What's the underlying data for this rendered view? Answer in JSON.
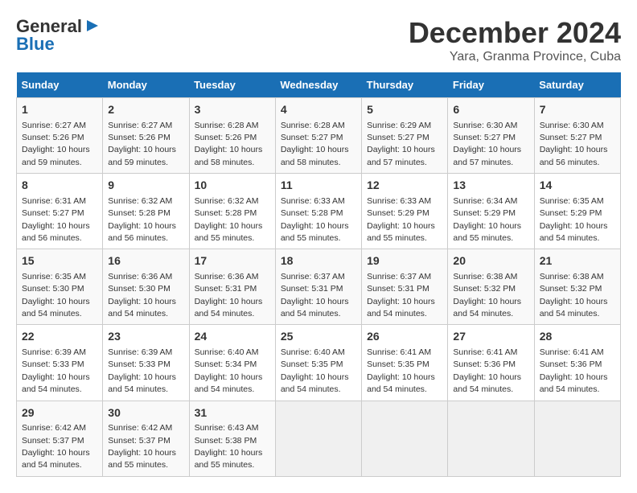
{
  "logo": {
    "line1": "General",
    "line2": "Blue"
  },
  "header": {
    "month": "December 2024",
    "location": "Yara, Granma Province, Cuba"
  },
  "weekdays": [
    "Sunday",
    "Monday",
    "Tuesday",
    "Wednesday",
    "Thursday",
    "Friday",
    "Saturday"
  ],
  "weeks": [
    [
      {
        "day": "1",
        "sunrise": "Sunrise: 6:27 AM",
        "sunset": "Sunset: 5:26 PM",
        "daylight": "Daylight: 10 hours and 59 minutes."
      },
      {
        "day": "2",
        "sunrise": "Sunrise: 6:27 AM",
        "sunset": "Sunset: 5:26 PM",
        "daylight": "Daylight: 10 hours and 59 minutes."
      },
      {
        "day": "3",
        "sunrise": "Sunrise: 6:28 AM",
        "sunset": "Sunset: 5:26 PM",
        "daylight": "Daylight: 10 hours and 58 minutes."
      },
      {
        "day": "4",
        "sunrise": "Sunrise: 6:28 AM",
        "sunset": "Sunset: 5:27 PM",
        "daylight": "Daylight: 10 hours and 58 minutes."
      },
      {
        "day": "5",
        "sunrise": "Sunrise: 6:29 AM",
        "sunset": "Sunset: 5:27 PM",
        "daylight": "Daylight: 10 hours and 57 minutes."
      },
      {
        "day": "6",
        "sunrise": "Sunrise: 6:30 AM",
        "sunset": "Sunset: 5:27 PM",
        "daylight": "Daylight: 10 hours and 57 minutes."
      },
      {
        "day": "7",
        "sunrise": "Sunrise: 6:30 AM",
        "sunset": "Sunset: 5:27 PM",
        "daylight": "Daylight: 10 hours and 56 minutes."
      }
    ],
    [
      {
        "day": "8",
        "sunrise": "Sunrise: 6:31 AM",
        "sunset": "Sunset: 5:27 PM",
        "daylight": "Daylight: 10 hours and 56 minutes."
      },
      {
        "day": "9",
        "sunrise": "Sunrise: 6:32 AM",
        "sunset": "Sunset: 5:28 PM",
        "daylight": "Daylight: 10 hours and 56 minutes."
      },
      {
        "day": "10",
        "sunrise": "Sunrise: 6:32 AM",
        "sunset": "Sunset: 5:28 PM",
        "daylight": "Daylight: 10 hours and 55 minutes."
      },
      {
        "day": "11",
        "sunrise": "Sunrise: 6:33 AM",
        "sunset": "Sunset: 5:28 PM",
        "daylight": "Daylight: 10 hours and 55 minutes."
      },
      {
        "day": "12",
        "sunrise": "Sunrise: 6:33 AM",
        "sunset": "Sunset: 5:29 PM",
        "daylight": "Daylight: 10 hours and 55 minutes."
      },
      {
        "day": "13",
        "sunrise": "Sunrise: 6:34 AM",
        "sunset": "Sunset: 5:29 PM",
        "daylight": "Daylight: 10 hours and 55 minutes."
      },
      {
        "day": "14",
        "sunrise": "Sunrise: 6:35 AM",
        "sunset": "Sunset: 5:29 PM",
        "daylight": "Daylight: 10 hours and 54 minutes."
      }
    ],
    [
      {
        "day": "15",
        "sunrise": "Sunrise: 6:35 AM",
        "sunset": "Sunset: 5:30 PM",
        "daylight": "Daylight: 10 hours and 54 minutes."
      },
      {
        "day": "16",
        "sunrise": "Sunrise: 6:36 AM",
        "sunset": "Sunset: 5:30 PM",
        "daylight": "Daylight: 10 hours and 54 minutes."
      },
      {
        "day": "17",
        "sunrise": "Sunrise: 6:36 AM",
        "sunset": "Sunset: 5:31 PM",
        "daylight": "Daylight: 10 hours and 54 minutes."
      },
      {
        "day": "18",
        "sunrise": "Sunrise: 6:37 AM",
        "sunset": "Sunset: 5:31 PM",
        "daylight": "Daylight: 10 hours and 54 minutes."
      },
      {
        "day": "19",
        "sunrise": "Sunrise: 6:37 AM",
        "sunset": "Sunset: 5:31 PM",
        "daylight": "Daylight: 10 hours and 54 minutes."
      },
      {
        "day": "20",
        "sunrise": "Sunrise: 6:38 AM",
        "sunset": "Sunset: 5:32 PM",
        "daylight": "Daylight: 10 hours and 54 minutes."
      },
      {
        "day": "21",
        "sunrise": "Sunrise: 6:38 AM",
        "sunset": "Sunset: 5:32 PM",
        "daylight": "Daylight: 10 hours and 54 minutes."
      }
    ],
    [
      {
        "day": "22",
        "sunrise": "Sunrise: 6:39 AM",
        "sunset": "Sunset: 5:33 PM",
        "daylight": "Daylight: 10 hours and 54 minutes."
      },
      {
        "day": "23",
        "sunrise": "Sunrise: 6:39 AM",
        "sunset": "Sunset: 5:33 PM",
        "daylight": "Daylight: 10 hours and 54 minutes."
      },
      {
        "day": "24",
        "sunrise": "Sunrise: 6:40 AM",
        "sunset": "Sunset: 5:34 PM",
        "daylight": "Daylight: 10 hours and 54 minutes."
      },
      {
        "day": "25",
        "sunrise": "Sunrise: 6:40 AM",
        "sunset": "Sunset: 5:35 PM",
        "daylight": "Daylight: 10 hours and 54 minutes."
      },
      {
        "day": "26",
        "sunrise": "Sunrise: 6:41 AM",
        "sunset": "Sunset: 5:35 PM",
        "daylight": "Daylight: 10 hours and 54 minutes."
      },
      {
        "day": "27",
        "sunrise": "Sunrise: 6:41 AM",
        "sunset": "Sunset: 5:36 PM",
        "daylight": "Daylight: 10 hours and 54 minutes."
      },
      {
        "day": "28",
        "sunrise": "Sunrise: 6:41 AM",
        "sunset": "Sunset: 5:36 PM",
        "daylight": "Daylight: 10 hours and 54 minutes."
      }
    ],
    [
      {
        "day": "29",
        "sunrise": "Sunrise: 6:42 AM",
        "sunset": "Sunset: 5:37 PM",
        "daylight": "Daylight: 10 hours and 54 minutes."
      },
      {
        "day": "30",
        "sunrise": "Sunrise: 6:42 AM",
        "sunset": "Sunset: 5:37 PM",
        "daylight": "Daylight: 10 hours and 55 minutes."
      },
      {
        "day": "31",
        "sunrise": "Sunrise: 6:43 AM",
        "sunset": "Sunset: 5:38 PM",
        "daylight": "Daylight: 10 hours and 55 minutes."
      },
      null,
      null,
      null,
      null
    ]
  ]
}
